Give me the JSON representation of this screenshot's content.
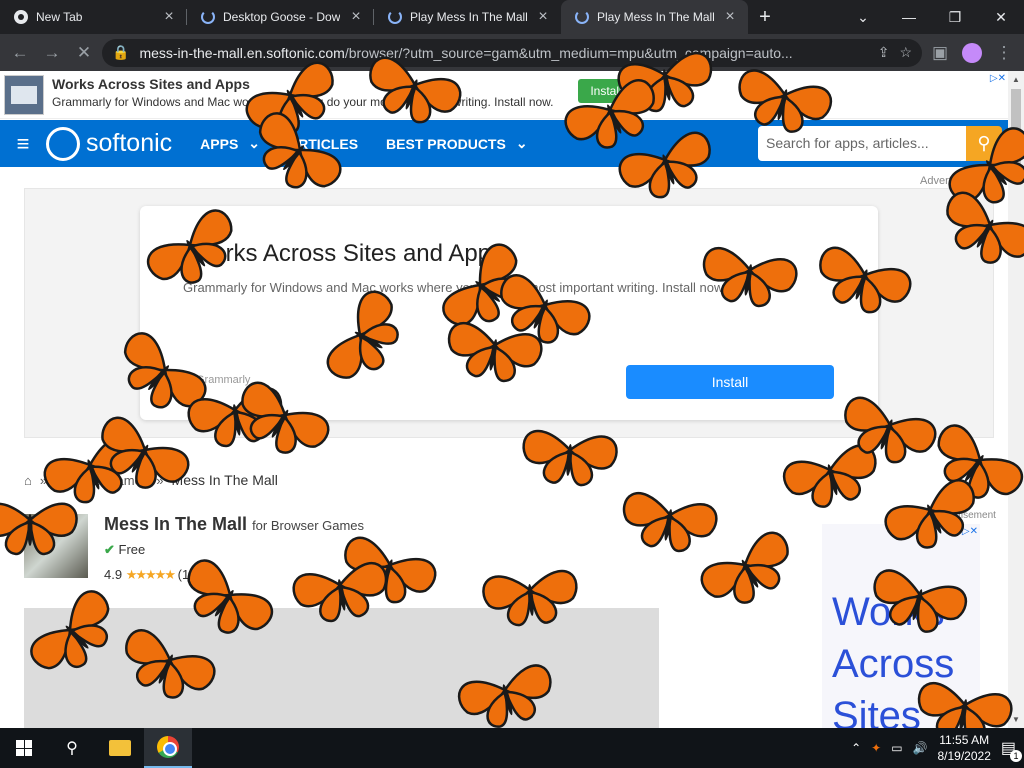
{
  "tabs": [
    {
      "title": "New Tab",
      "icon": "chrome-icon"
    },
    {
      "title": "Desktop Goose - Down",
      "icon": "loading-spinner-icon"
    },
    {
      "title": "Play Mess In The Mall (",
      "icon": "loading-spinner-icon"
    },
    {
      "title": "Play Mess In The Mall (",
      "icon": "loading-spinner-icon",
      "active": true
    }
  ],
  "toolbar": {
    "url_host": "mess-in-the-mall.en.softonic.com",
    "url_rest": "/browser/?utm_source=gam&utm_medium=mpu&utm_campaign=auto..."
  },
  "top_ad": {
    "heading": "Works Across Sites and Apps",
    "text": "Grammarly for Windows and Mac works where you do your most important writing. Install now.",
    "button": "Install"
  },
  "nav": {
    "logo": "softonic",
    "items": [
      "APPS",
      "ARTICLES",
      "BEST PRODUCTS"
    ],
    "search_placeholder": "Search for apps, articles..."
  },
  "advert_label": "Advertisement",
  "main_ad": {
    "heading": "Works Across Sites and Apps",
    "text": "Grammarly for Windows and Mac works where you do your most important writing. Install now.",
    "small": "Grammarly",
    "button": "Install"
  },
  "breadcrumb": {
    "parent": "Browser Games",
    "sep": "»",
    "current": "Mess In The Mall"
  },
  "app": {
    "name": "Mess In The Mall",
    "category": "for Browser Games",
    "license": "Free",
    "rating": "4.9",
    "stars": "★★★★★",
    "votes": "(1"
  },
  "side_ad": {
    "label": "Advertisement",
    "text": "Works Across Sites"
  },
  "taskbar": {
    "time": "11:55 AM",
    "date": "8/19/2022",
    "notifications": "1"
  },
  "overlay": {
    "butterfly_color": "#ee6f0c",
    "butterfly_count": 46
  }
}
